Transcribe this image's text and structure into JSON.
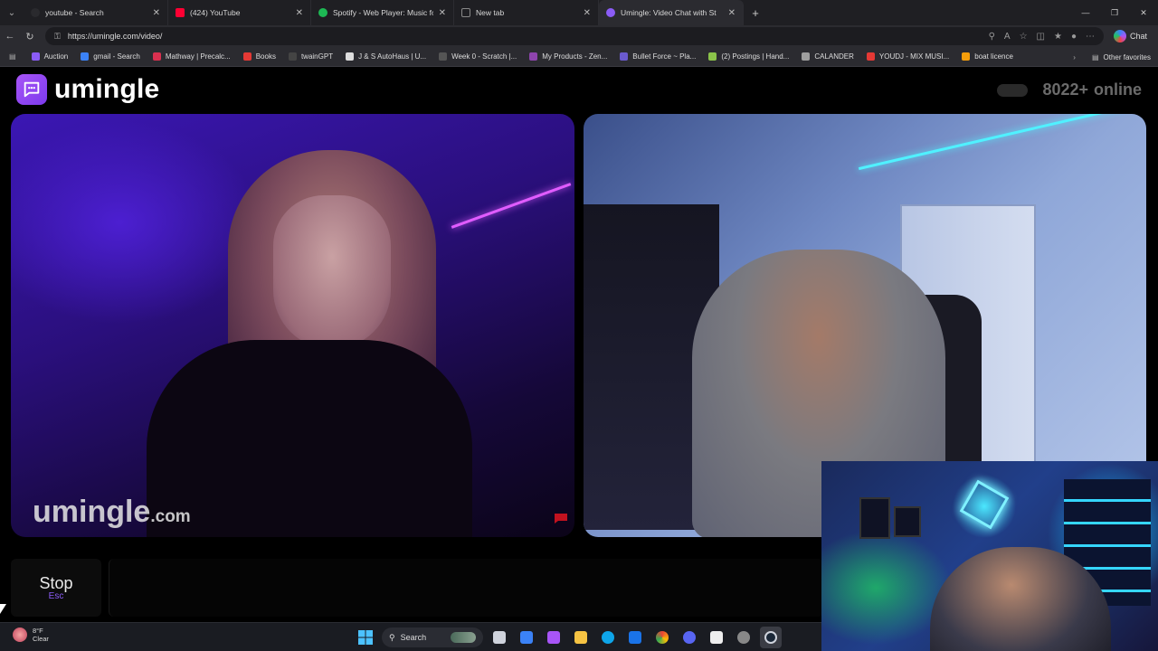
{
  "browser": {
    "tabs": [
      {
        "title": "youtube - Search",
        "color": "#2a2a2e",
        "active": false
      },
      {
        "title": "(424) YouTube",
        "color": "#ff0033",
        "active": false
      },
      {
        "title": "Spotify - Web Player: Music for ev",
        "color": "#1db954",
        "active": false
      },
      {
        "title": "New tab",
        "color": "#6b6b6b",
        "active": false
      },
      {
        "title": "Umingle: Video Chat with St",
        "color": "#8b5cf6",
        "active": true
      }
    ],
    "url": "https://umingle.com/video/",
    "chat_label": "Chat",
    "bookmarks": [
      {
        "label": "Auction",
        "color": "#8b5cf6"
      },
      {
        "label": "gmail - Search",
        "color": "#3b82f6"
      },
      {
        "label": "Mathway | Precalc...",
        "color": "#d9304f"
      },
      {
        "label": "Books",
        "color": "#e53935"
      },
      {
        "label": "twainGPT",
        "color": "#444"
      },
      {
        "label": "J & S AutoHaus | U...",
        "color": "#ddd"
      },
      {
        "label": "Week 0 - Scratch |...",
        "color": "#555"
      },
      {
        "label": "My Products - Zen...",
        "color": "#8e44ad"
      },
      {
        "label": "Bullet Force ~ Pla...",
        "color": "#6a5acd"
      },
      {
        "label": "(2) Postings | Hand...",
        "color": "#8bc34a"
      },
      {
        "label": "CALANDER",
        "color": "#9e9e9e"
      },
      {
        "label": "YOUDJ - MIX MUSI...",
        "color": "#e53935"
      },
      {
        "label": "boat licence",
        "color": "#f59e0b"
      }
    ],
    "other_favorites": "Other favorites"
  },
  "site": {
    "brand": "umingle",
    "online_count": "8022+",
    "online_label": "online",
    "watermark_main": "umingle",
    "watermark_suffix": ".com",
    "stop_label": "Stop",
    "stop_key": "Esc",
    "accent": "#8b5cf6"
  },
  "taskbar": {
    "weather_temp": "8°F",
    "weather_desc": "Clear",
    "search_label": "Search",
    "apps": [
      {
        "name": "task-view",
        "color": "#cfd3dc"
      },
      {
        "name": "calendar",
        "color": "#3b82f6"
      },
      {
        "name": "copilot",
        "color": "#a855f7"
      },
      {
        "name": "file-explorer",
        "color": "#f6c343"
      },
      {
        "name": "edge",
        "color": "#0ea5e9"
      },
      {
        "name": "outlook",
        "color": "#1a73e8"
      },
      {
        "name": "chrome",
        "color": "#f2b705"
      },
      {
        "name": "discord",
        "color": "#5865f2"
      },
      {
        "name": "capcut",
        "color": "#eee"
      },
      {
        "name": "obs",
        "color": "#888"
      },
      {
        "name": "steam",
        "color": "#1b2838"
      }
    ]
  }
}
